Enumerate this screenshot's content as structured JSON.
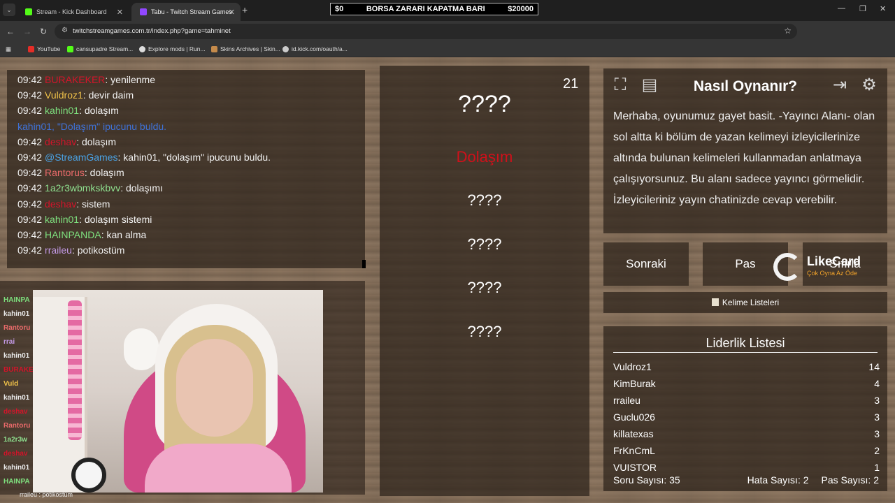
{
  "browser": {
    "tabs": [
      {
        "label": "Stream - Kick Dashboard",
        "active": false
      },
      {
        "label": "Tabu - Twitch Stream Games",
        "active": true
      }
    ],
    "banner": {
      "left": "$0",
      "title": "BORSA ZARARI KAPATMA BARI",
      "right": "$20000"
    },
    "url": "twitchstreamgames.com.tr/index.php?game=tahminet",
    "bookmarks": [
      "YouTube",
      "cansupadre Stream...",
      "Explore mods | Run...",
      "Skins Archives | Skin...",
      "id.kick.com/oauth/a..."
    ]
  },
  "chat": {
    "lines": [
      {
        "time": "09:42",
        "user": "BURAKEKER",
        "user_color": "#d4142a",
        "msg": ": yenilenme"
      },
      {
        "time": "09:42",
        "user": "Vuldroz1",
        "user_color": "#f0c24a",
        "msg": ": devir daim"
      },
      {
        "time": "09:42",
        "user": "kahin01",
        "user_color": "#7ee07e",
        "msg": ": dolaşım"
      },
      {
        "time": "",
        "user": "kahin01,",
        "user_color": "#3f72d8",
        "msg": " \"Dolaşım\" ipucunu buldu.",
        "system": true
      },
      {
        "time": "09:42",
        "user": "deshav",
        "user_color": "#d4142a",
        "msg": ": dolaşım"
      },
      {
        "time": "09:42",
        "user": "@StreamGames",
        "user_color": "#4aa3e6",
        "msg": ": kahin01, \"dolaşım\" ipucunu buldu."
      },
      {
        "time": "09:42",
        "user": "Rantorus",
        "user_color": "#ea6a6a",
        "msg": ": dolaşım"
      },
      {
        "time": "09:42",
        "user": "1a2r3wbmkskbvv",
        "user_color": "#8fe08f",
        "msg": ": dolaşımı"
      },
      {
        "time": "09:42",
        "user": "deshav",
        "user_color": "#d4142a",
        "msg": ": sistem"
      },
      {
        "time": "09:42",
        "user": "kahin01",
        "user_color": "#7ee07e",
        "msg": ": dolaşım sistemi"
      },
      {
        "time": "09:42",
        "user": "HAINPANDA",
        "user_color": "#7ee07e",
        "msg": ": kan alma"
      },
      {
        "time": "09:42",
        "user": "rraileu",
        "user_color": "#c39ae6",
        "msg": ": potikostüm"
      }
    ]
  },
  "game": {
    "timer": "21",
    "main_word": "????",
    "found_hint": "Dolaşım",
    "hidden_hints": [
      "????",
      "????",
      "????",
      "????"
    ]
  },
  "howto": {
    "title": "Nasıl Oynanır?",
    "body": "Merhaba, oyunumuz gayet basit. -Yayıncı Alanı- olan sol altta ki bölüm de yazan kelimeyi izleyicilerinize altında bulunan kelimeleri kullanmadan anlatmaya çalışıyorsunuz. Bu alanı sadece yayıncı görmelidir. İzleyicileriniz yayın chatinizde cevap verebilir.",
    "icons": [
      "fullscreen-icon",
      "document-icon",
      "logout-icon",
      "gear-icon"
    ]
  },
  "controls": {
    "next": "Sonraki",
    "pass": "Pas",
    "reset": "Sıfırla",
    "word_lists": "Kelime Listeleri"
  },
  "sponsor": {
    "name": "LikeCard",
    "tag": "Çok Oyna Az Öde"
  },
  "leaderboard": {
    "title": "Liderlik Listesi",
    "rows": [
      {
        "name": "Vuldroz1",
        "score": "14"
      },
      {
        "name": "KimBurak",
        "score": "4"
      },
      {
        "name": "rraileu",
        "score": "3"
      },
      {
        "name": "Guclu026",
        "score": "3"
      },
      {
        "name": "killatexas",
        "score": "3"
      },
      {
        "name": "FrKnCmL",
        "score": "2"
      },
      {
        "name": "VUISTOR",
        "score": "1"
      }
    ],
    "footer": {
      "questions": "Soru Sayısı: 35",
      "errors": "Hata Sayısı: 2",
      "passes": "Pas Sayısı: 2"
    }
  },
  "overlay_chat": {
    "names": [
      {
        "n": "HAINPA",
        "c": "#7ee07e"
      },
      {
        "n": "kahin01",
        "c": "#e8e8e8"
      },
      {
        "n": "Rantoru",
        "c": "#ea6a6a"
      },
      {
        "n": "rrai",
        "c": "#c39ae6"
      },
      {
        "n": "kahin01",
        "c": "#e8e8e8"
      },
      {
        "n": "BURAKE",
        "c": "#d4142a"
      },
      {
        "n": "Vuld",
        "c": "#f0c24a"
      },
      {
        "n": "kahin01",
        "c": "#e8e8e8"
      },
      {
        "n": "deshav",
        "c": "#d4142a"
      },
      {
        "n": "Rantoru",
        "c": "#ea6a6a"
      },
      {
        "n": "1a2r3w",
        "c": "#8fe08f"
      },
      {
        "n": "deshav",
        "c": "#d4142a"
      },
      {
        "n": "kahin01",
        "c": "#e8e8e8"
      },
      {
        "n": "HAINPA",
        "c": "#7ee07e"
      }
    ],
    "caption": "rraileu : potikostüm"
  }
}
